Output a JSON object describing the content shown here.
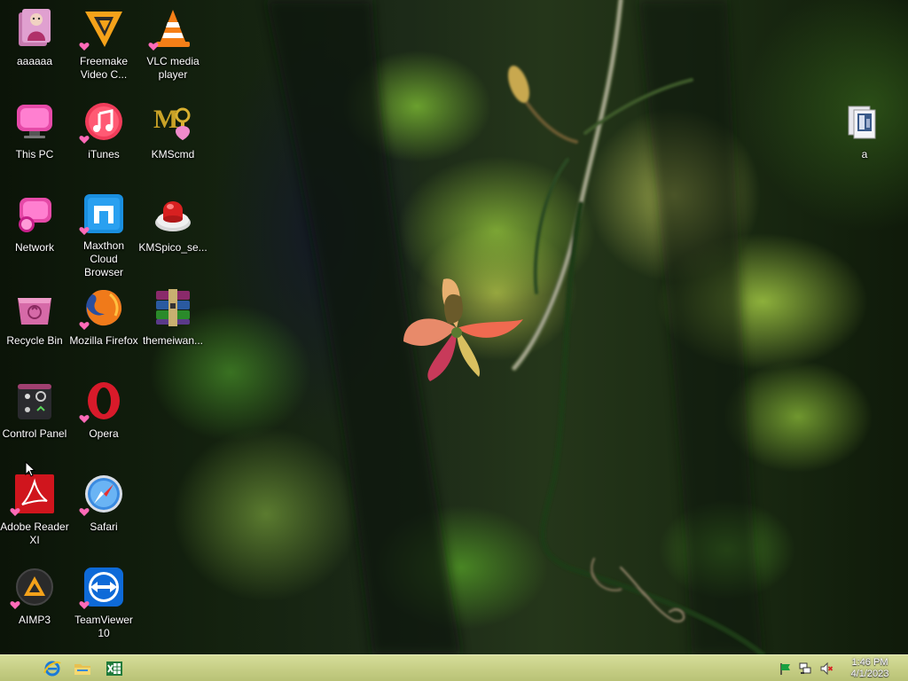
{
  "desktop": {
    "icons": [
      {
        "label": "aaaaaa"
      },
      {
        "label": "Freemake Video C..."
      },
      {
        "label": "VLC media player"
      },
      {
        "label": "This PC"
      },
      {
        "label": "iTunes"
      },
      {
        "label": "KMScmd"
      },
      {
        "label": "Network"
      },
      {
        "label": "Maxthon Cloud Browser"
      },
      {
        "label": "KMSpico_se..."
      },
      {
        "label": "Recycle Bin"
      },
      {
        "label": "Mozilla Firefox"
      },
      {
        "label": "themeiwan..."
      },
      {
        "label": "Control Panel"
      },
      {
        "label": "Opera"
      },
      {
        "label": "Adobe Reader XI"
      },
      {
        "label": "Safari"
      },
      {
        "label": "AIMP3"
      },
      {
        "label": "TeamViewer 10"
      },
      {
        "label": "a"
      }
    ]
  },
  "taskbar": {
    "pinned": [
      "internet-explorer-icon",
      "file-explorer-icon",
      "excel-icon"
    ],
    "tray": [
      "action-center-flag-icon",
      "network-icon",
      "volume-muted-icon"
    ],
    "clock": {
      "time": "1:46 PM",
      "date": "4/1/2023"
    }
  },
  "colors": {
    "taskbar": "#c7cf86",
    "icon_label_text": "#ffffff"
  }
}
